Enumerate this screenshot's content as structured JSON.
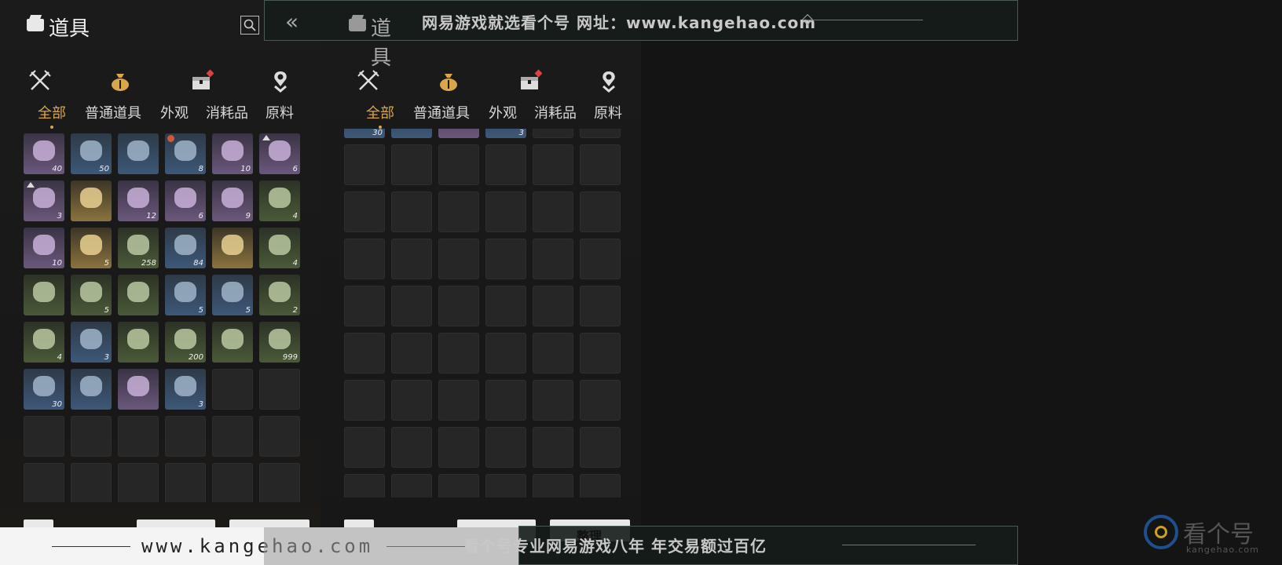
{
  "header": {
    "title": "道具"
  },
  "tabs": [
    {
      "label": "全部",
      "active": true
    },
    {
      "label": "普通道具",
      "active": false
    },
    {
      "label": "外观",
      "active": false
    },
    {
      "label": "消耗品",
      "active": false
    },
    {
      "label": "原料",
      "active": false
    }
  ],
  "category_icons": [
    "crossed-swords-icon",
    "money-bag-icon",
    "treasure-chest-icon",
    "location-pin-icon"
  ],
  "accent_color": "#d9a64a",
  "inventory": [
    {
      "q": "purple",
      "qty": "40"
    },
    {
      "q": "blue",
      "qty": "50"
    },
    {
      "q": "blue",
      "qty": ""
    },
    {
      "q": "blue",
      "qty": "8",
      "badge": true
    },
    {
      "q": "purple",
      "qty": "10"
    },
    {
      "q": "purple",
      "qty": "6",
      "arrow": true
    },
    {
      "q": "purple",
      "qty": "3",
      "arrow": true
    },
    {
      "q": "gold",
      "qty": ""
    },
    {
      "q": "purple",
      "qty": "12"
    },
    {
      "q": "purple",
      "qty": "6"
    },
    {
      "q": "purple",
      "qty": "9"
    },
    {
      "q": "green",
      "qty": "4"
    },
    {
      "q": "purple",
      "qty": "10"
    },
    {
      "q": "gold",
      "qty": "5"
    },
    {
      "q": "green",
      "qty": "258"
    },
    {
      "q": "blue",
      "qty": "84"
    },
    {
      "q": "gold",
      "qty": ""
    },
    {
      "q": "green",
      "qty": "4"
    },
    {
      "q": "green",
      "qty": ""
    },
    {
      "q": "green",
      "qty": "5"
    },
    {
      "q": "green",
      "qty": ""
    },
    {
      "q": "blue",
      "qty": "5"
    },
    {
      "q": "blue",
      "qty": "5"
    },
    {
      "q": "green",
      "qty": "2"
    },
    {
      "q": "green",
      "qty": "4"
    },
    {
      "q": "blue",
      "qty": "3"
    },
    {
      "q": "green",
      "qty": ""
    },
    {
      "q": "green",
      "qty": "200"
    },
    {
      "q": "green",
      "qty": ""
    },
    {
      "q": "green",
      "qty": "999"
    },
    {
      "q": "blue",
      "qty": "30"
    },
    {
      "q": "blue",
      "qty": ""
    },
    {
      "q": "purple",
      "qty": ""
    },
    {
      "q": "blue",
      "qty": "3"
    },
    {
      "q": "empty",
      "qty": ""
    },
    {
      "q": "empty",
      "qty": ""
    }
  ],
  "right_top_row": [
    {
      "q": "blue",
      "qty": "30"
    },
    {
      "q": "blue",
      "qty": ""
    },
    {
      "q": "purple",
      "qty": ""
    },
    {
      "q": "blue",
      "qty": "3"
    },
    {
      "q": "empty",
      "qty": ""
    },
    {
      "q": "empty",
      "qty": ""
    }
  ],
  "watermark": {
    "top_text": "网易游戏就选看个号  网址：www.kangehao.com",
    "url": "www.kangehao.com",
    "slogan": "看个号专业网易游戏八年   年交易额过百亿",
    "sort_label": "整理",
    "logo_name": "看个号",
    "logo_sub": "kangehao.com"
  }
}
